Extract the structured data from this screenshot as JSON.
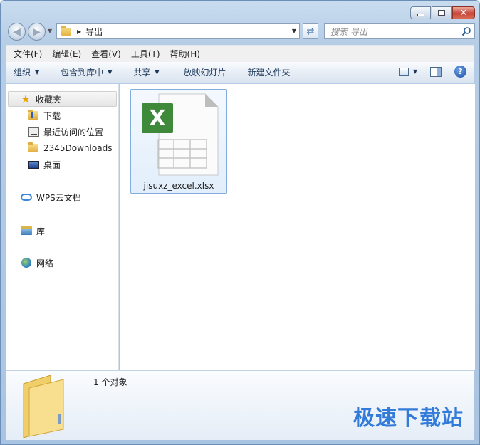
{
  "window": {
    "buttons": {
      "minimize": "minimize",
      "maximize": "maximize",
      "close": "✕"
    }
  },
  "navigation": {
    "address_path": "导出",
    "search_placeholder": "搜索 导出"
  },
  "menubar": {
    "items": [
      "文件(F)",
      "编辑(E)",
      "查看(V)",
      "工具(T)",
      "帮助(H)"
    ]
  },
  "commandbar": {
    "organize": "组织",
    "include_in_library": "包含到库中",
    "share": "共享",
    "slideshow": "放映幻灯片",
    "new_folder": "新建文件夹",
    "help_glyph": "?"
  },
  "sidebar": {
    "favorites": "收藏夹",
    "items": [
      "下载",
      "最近访问的位置",
      "2345Downloads",
      "桌面"
    ],
    "wps_cloud": "WPS云文档",
    "library": "库",
    "network": "网络"
  },
  "content": {
    "files": [
      {
        "name": "jisuxz_excel.xlsx",
        "icon": "excel-file-icon",
        "badge": "X"
      }
    ]
  },
  "details": {
    "count_text": "1 个对象"
  },
  "watermark": "极速下载站",
  "colors": {
    "excel_green": "#3f8a3a",
    "accent_blue": "#1f6fd6"
  }
}
